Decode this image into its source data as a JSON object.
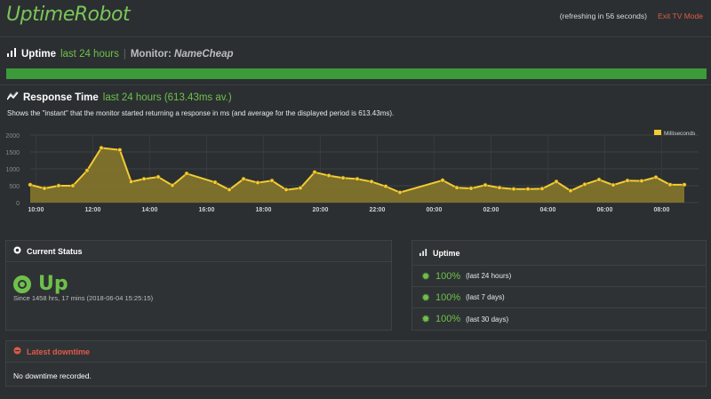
{
  "header": {
    "logo": "UptimeRobot",
    "refresh_text": "(refreshing in 56 seconds)",
    "exit_label": "Exit TV Mode"
  },
  "uptime_section": {
    "title": "Uptime",
    "period": "last 24 hours",
    "monitor_label": "Monitor:",
    "monitor_name": "NameCheap",
    "uptime_fraction": 1.0,
    "bar_color": "#3c9a3a"
  },
  "response_section": {
    "title": "Response Time",
    "period": "last 24 hours (613.43ms av.)",
    "description": "Shows the \"instant\" that the monitor started returning a response in ms (and average for the displayed period is 613.43ms)."
  },
  "chart_data": {
    "type": "area",
    "legend": "Milliseconds",
    "ylim": [
      0,
      2000
    ],
    "yticks": [
      0,
      500,
      1000,
      1500,
      2000
    ],
    "xticks": [
      "10:00",
      "12:00",
      "14:00",
      "16:00",
      "18:00",
      "20:00",
      "22:00",
      "00:00",
      "02:00",
      "04:00",
      "06:00",
      "08:00"
    ],
    "grid": true,
    "legend_position": "top-right",
    "series_color": "#f3cb33",
    "x_hours": [
      9.8,
      10.3,
      10.8,
      11.3,
      11.8,
      12.3,
      12.95,
      13.35,
      13.8,
      14.3,
      14.8,
      15.3,
      16.3,
      16.8,
      17.3,
      17.8,
      18.3,
      18.8,
      19.3,
      19.8,
      20.3,
      20.8,
      21.3,
      21.8,
      22.3,
      22.8,
      24.3,
      24.8,
      25.3,
      25.8,
      26.3,
      26.8,
      27.3,
      27.8,
      28.3,
      28.8,
      29.3,
      29.8,
      30.3,
      30.8,
      31.3,
      31.8,
      32.3,
      32.8
    ],
    "values": [
      530,
      420,
      500,
      500,
      950,
      1620,
      1560,
      620,
      700,
      760,
      510,
      860,
      600,
      380,
      700,
      590,
      650,
      380,
      430,
      900,
      800,
      730,
      700,
      620,
      480,
      300,
      660,
      440,
      420,
      520,
      440,
      400,
      400,
      410,
      620,
      350,
      540,
      680,
      520,
      650,
      640,
      750,
      530,
      530
    ]
  },
  "current_status": {
    "title": "Current Status",
    "status": "Up",
    "since": "Since 1458 hrs, 17 mins (2018-06-04 15:25:15)"
  },
  "uptime_panel": {
    "title": "Uptime",
    "rows": [
      {
        "pct": "100%",
        "label": "(last 24 hours)"
      },
      {
        "pct": "100%",
        "label": "(last 7 days)"
      },
      {
        "pct": "100%",
        "label": "(last 30 days)"
      }
    ]
  },
  "downtime": {
    "title": "Latest downtime",
    "message": "No downtime recorded."
  }
}
